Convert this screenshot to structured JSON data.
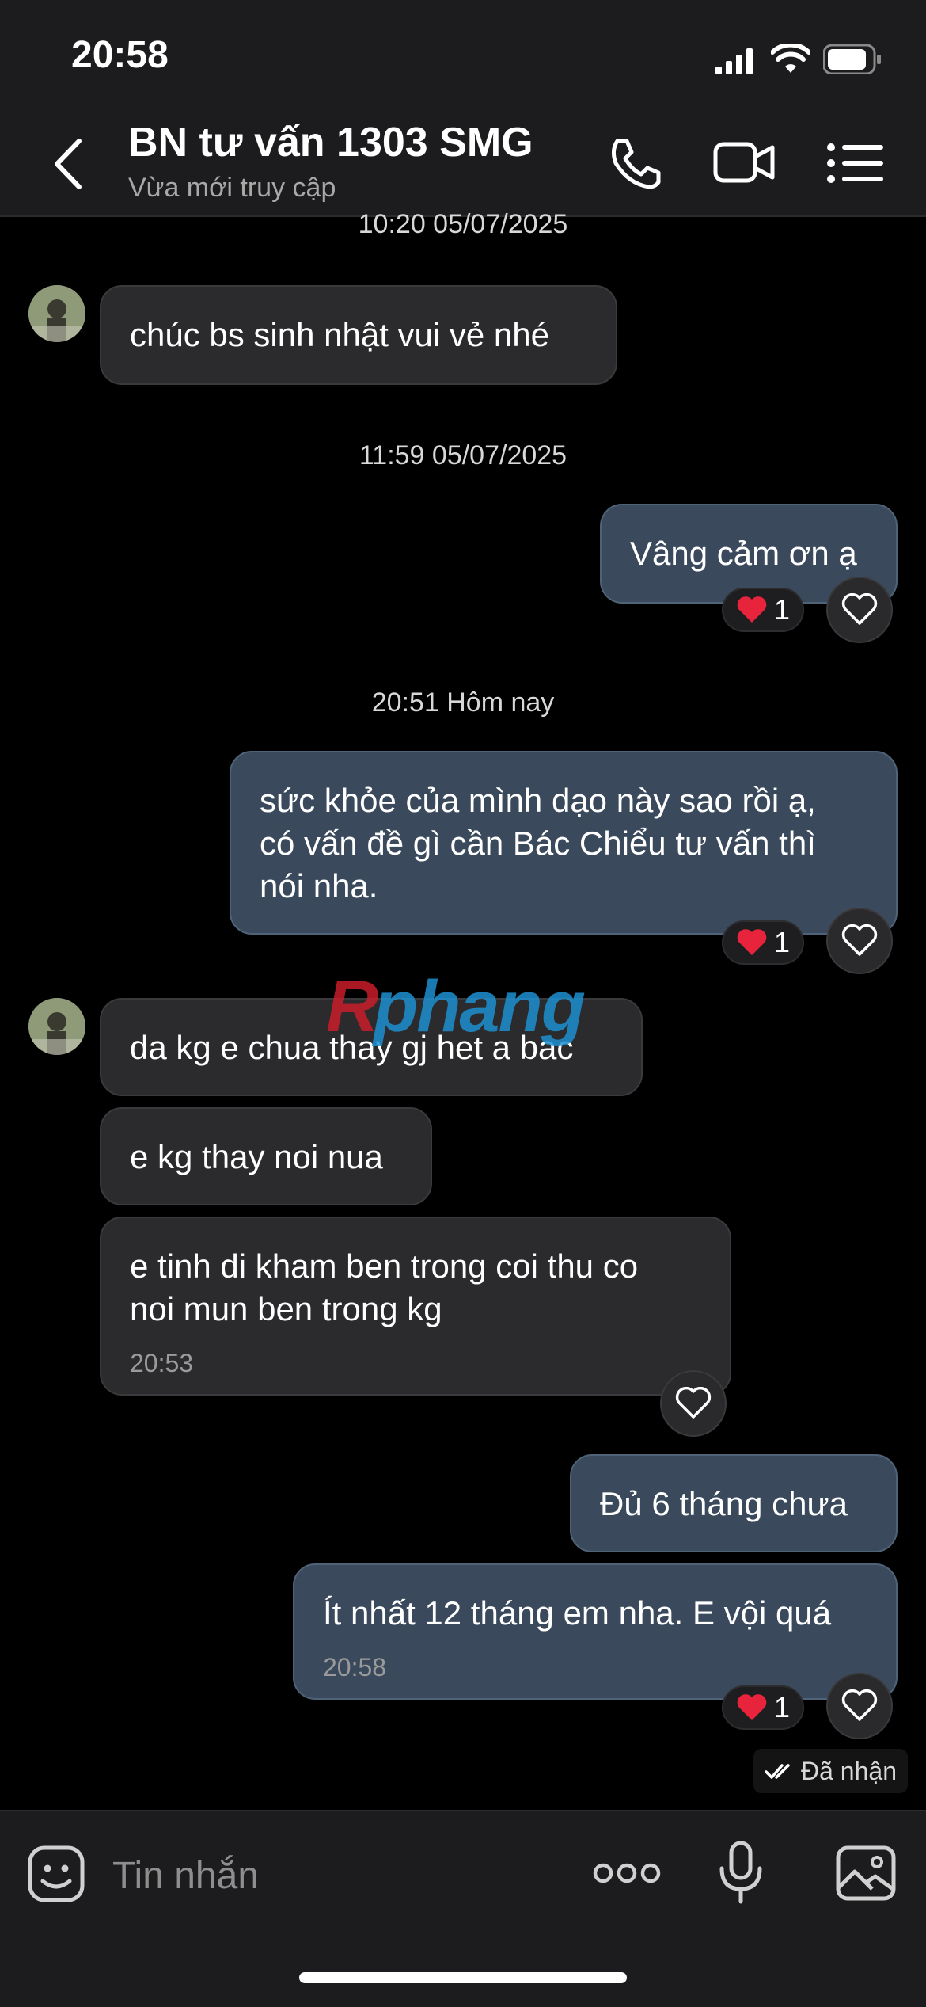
{
  "status_bar": {
    "time": "20:58"
  },
  "header": {
    "title": "BN tư vấn 1303 SMG",
    "subtitle": "Vừa mới truy cập",
    "icons": [
      "back-chevron-icon",
      "phone-icon",
      "video-call-icon",
      "menu-list-icon"
    ]
  },
  "messages": {
    "ts0": "10:20 05/07/2025",
    "m1": "chúc bs sinh nhật vui vẻ nhé",
    "ts1": "11:59 05/07/2025",
    "m2": "Vâng cảm ơn ạ",
    "m2_react": "1",
    "ts2": "20:51 Hôm nay",
    "m3_l1": "sức khỏe của mình dạo này sao rồi ạ,",
    "m3_l2": "có vấn đề gì cần Bác Chiểu tư vấn thì",
    "m3_l3": "nói nha.",
    "m3_react": "1",
    "m4": "da kg e chua thay gj het a bac",
    "m5": "e kg thay noi nua",
    "m6_l1": "e tinh di kham ben trong coi thu co",
    "m6_l2": "noi mun ben trong kg",
    "m6_time": "20:53",
    "m7": "Đủ 6 tháng chưa",
    "m8": "Ít nhất 12 tháng em nha. E vội quá",
    "m8_time": "20:58",
    "m8_react": "1"
  },
  "delivery_status": "Đã nhận",
  "watermark": "Rphang",
  "composer": {
    "placeholder": "Tin nhắn"
  },
  "colors": {
    "header_bg": "#1c1c1e",
    "incoming_bubble": "#2b2b2d",
    "outgoing_bubble": "#3a4a5c",
    "heart": "#e8243c"
  }
}
